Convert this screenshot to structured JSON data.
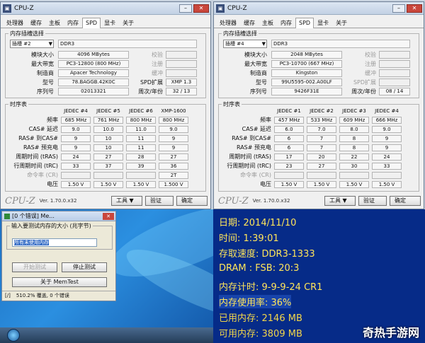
{
  "cpuz_left": {
    "title": "CPU-Z",
    "tabs": [
      "处理器",
      "缓存",
      "主板",
      "内存",
      "SPD",
      "显卡",
      "关于"
    ],
    "active_tab": "SPD",
    "slot_section": "内存插槽选择",
    "slot": "插槽 #2",
    "mem_type": "DDR3",
    "labels": [
      "模块大小",
      "最大带宽",
      "制造商",
      "型号",
      "序列号"
    ],
    "values": [
      "4096 MBytes",
      "PC3-12800 (800 MHz)",
      "Apacer Technology",
      "78.BAGGB.42K0C",
      "02013321"
    ],
    "right_labels": [
      "校验",
      "注册",
      "缓冲",
      "SPD扩展",
      "周次/年份"
    ],
    "right_values": [
      "",
      "",
      "",
      "XMP 1.3",
      "32 / 13"
    ],
    "timings_section": "时序表",
    "timing_headers": [
      "JEDEC #4",
      "JEDEC #5",
      "JEDEC #6",
      "XMP-1600"
    ],
    "timing_labels": [
      "频率",
      "CAS# 延迟",
      "RAS# 到CAS#",
      "RAS# 预充电",
      "周期时间 (tRAS)",
      "行周期时间 (tRC)",
      "命令率 (CR)",
      "电压"
    ],
    "timing_rows": [
      [
        "685 MHz",
        "761 MHz",
        "800 MHz",
        "800 MHz"
      ],
      [
        "9.0",
        "10.0",
        "11.0",
        "9.0"
      ],
      [
        "9",
        "10",
        "11",
        "9"
      ],
      [
        "9",
        "10",
        "11",
        "9"
      ],
      [
        "24",
        "27",
        "28",
        "27"
      ],
      [
        "33",
        "37",
        "39",
        "36"
      ],
      [
        "",
        "",
        "",
        "2T"
      ],
      [
        "1.50 V",
        "1.50 V",
        "1.50 V",
        "1.500 V"
      ]
    ],
    "brand": "CPU-Z",
    "version": "Ver. 1.70.0.x32",
    "tools": "工具",
    "validate": "验证",
    "ok": "确定"
  },
  "cpuz_right": {
    "title": "CPU-Z",
    "tabs": [
      "处理器",
      "缓存",
      "主板",
      "内存",
      "SPD",
      "显卡",
      "关于"
    ],
    "active_tab": "SPD",
    "slot_section": "内存插槽选择",
    "slot": "插槽 #4",
    "mem_type": "DDR3",
    "labels": [
      "模块大小",
      "最大带宽",
      "制造商",
      "型号",
      "序列号"
    ],
    "values": [
      "2048 MBytes",
      "PC3-10700 (667 MHz)",
      "Kingston",
      "99U5595-002.A00LF",
      "9426F31E"
    ],
    "right_labels": [
      "校验",
      "注册",
      "缓冲",
      "SPD扩展",
      "周次/年份"
    ],
    "right_values": [
      "",
      "",
      "",
      "",
      "08 / 14"
    ],
    "timings_section": "时序表",
    "timing_headers": [
      "JEDEC #1",
      "JEDEC #2",
      "JEDEC #3",
      "JEDEC #4"
    ],
    "timing_labels": [
      "频率",
      "CAS# 延迟",
      "RAS# 到CAS#",
      "RAS# 预充电",
      "周期时间 (tRAS)",
      "行周期时间 (tRC)",
      "命令率 (CR)",
      "电压"
    ],
    "timing_rows": [
      [
        "457 MHz",
        "533 MHz",
        "609 MHz",
        "666 MHz"
      ],
      [
        "6.0",
        "7.0",
        "8.0",
        "9.0"
      ],
      [
        "6",
        "7",
        "8",
        "9"
      ],
      [
        "6",
        "7",
        "8",
        "9"
      ],
      [
        "17",
        "20",
        "22",
        "24"
      ],
      [
        "23",
        "27",
        "30",
        "33"
      ],
      [
        "",
        "",
        "",
        ""
      ],
      [
        "1.50 V",
        "1.50 V",
        "1.50 V",
        "1.50 V"
      ]
    ],
    "brand": "CPU-Z",
    "version": "Ver. 1.70.0.x32",
    "tools": "工具",
    "validate": "验证",
    "ok": "确定"
  },
  "memtest": {
    "title": "[0 个错误] Me...",
    "group_label": "输入要测试内存的大小 (兆字节)",
    "input_value": "所有未使用内存",
    "start": "开始测试",
    "stop": "停止测试",
    "about": "关于 MemTest",
    "status_a": "[/]",
    "status_b": "510.2% 覆盖, 0 个错误"
  },
  "info": {
    "date": "日期: 2014/11/10",
    "time": "时间: 1:39:01",
    "speed": "存取速度: DDR3-1333",
    "dram": "DRAM : FSB: 20:3",
    "timing": "内存计时: 9-9-9-24 CR1",
    "usage": "内存使用率: 36%",
    "used": "已用内存: 2146 MB",
    "avail": "可用内存: 3809 MB"
  },
  "watermark": "奇热手游网"
}
